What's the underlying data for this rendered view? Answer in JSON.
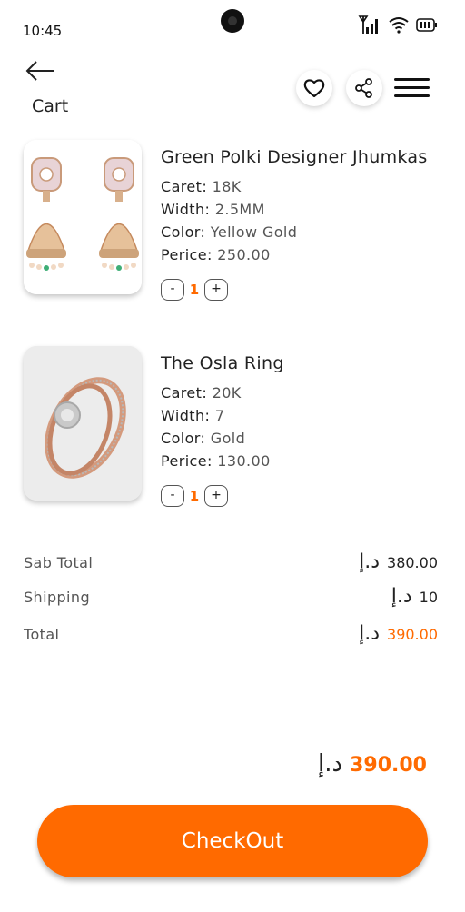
{
  "status_bar": {
    "time": "10:45"
  },
  "header": {
    "title": "Cart"
  },
  "items": [
    {
      "name": "Green Polki Designer Jhumkas",
      "caret_label": "Caret:",
      "caret": "18K",
      "width_label": "Width:",
      "width": "2.5MM",
      "color_label": "Color:",
      "color": "Yellow Gold",
      "price_label": "Perice:",
      "price": "250.00",
      "qty_minus": "-",
      "qty": "1",
      "qty_plus": "+"
    },
    {
      "name": "The Osla Ring",
      "caret_label": "Caret:",
      "caret": "20K",
      "width_label": "Width:",
      "width": "7",
      "color_label": "Color:",
      "color": "Gold",
      "price_label": "Perice:",
      "price": "130.00",
      "qty_minus": "-",
      "qty": "1",
      "qty_plus": "+"
    }
  ],
  "summary": {
    "currency": "د.إ",
    "subtotal_label": "Sab Total",
    "subtotal": "380.00",
    "shipping_label": "Shipping",
    "shipping": "10",
    "total_label": "Total",
    "total": "390.00"
  },
  "grand_total": {
    "currency": "د.إ",
    "value": "390.00"
  },
  "checkout": {
    "label": "CheckOut"
  },
  "colors": {
    "accent": "#ff6a00",
    "text": "#222222"
  },
  "icons": [
    "camera-icon",
    "signal-icon",
    "wifi-icon",
    "battery-icon",
    "back-arrow-icon",
    "heart-icon",
    "share-icon",
    "menu-icon"
  ]
}
